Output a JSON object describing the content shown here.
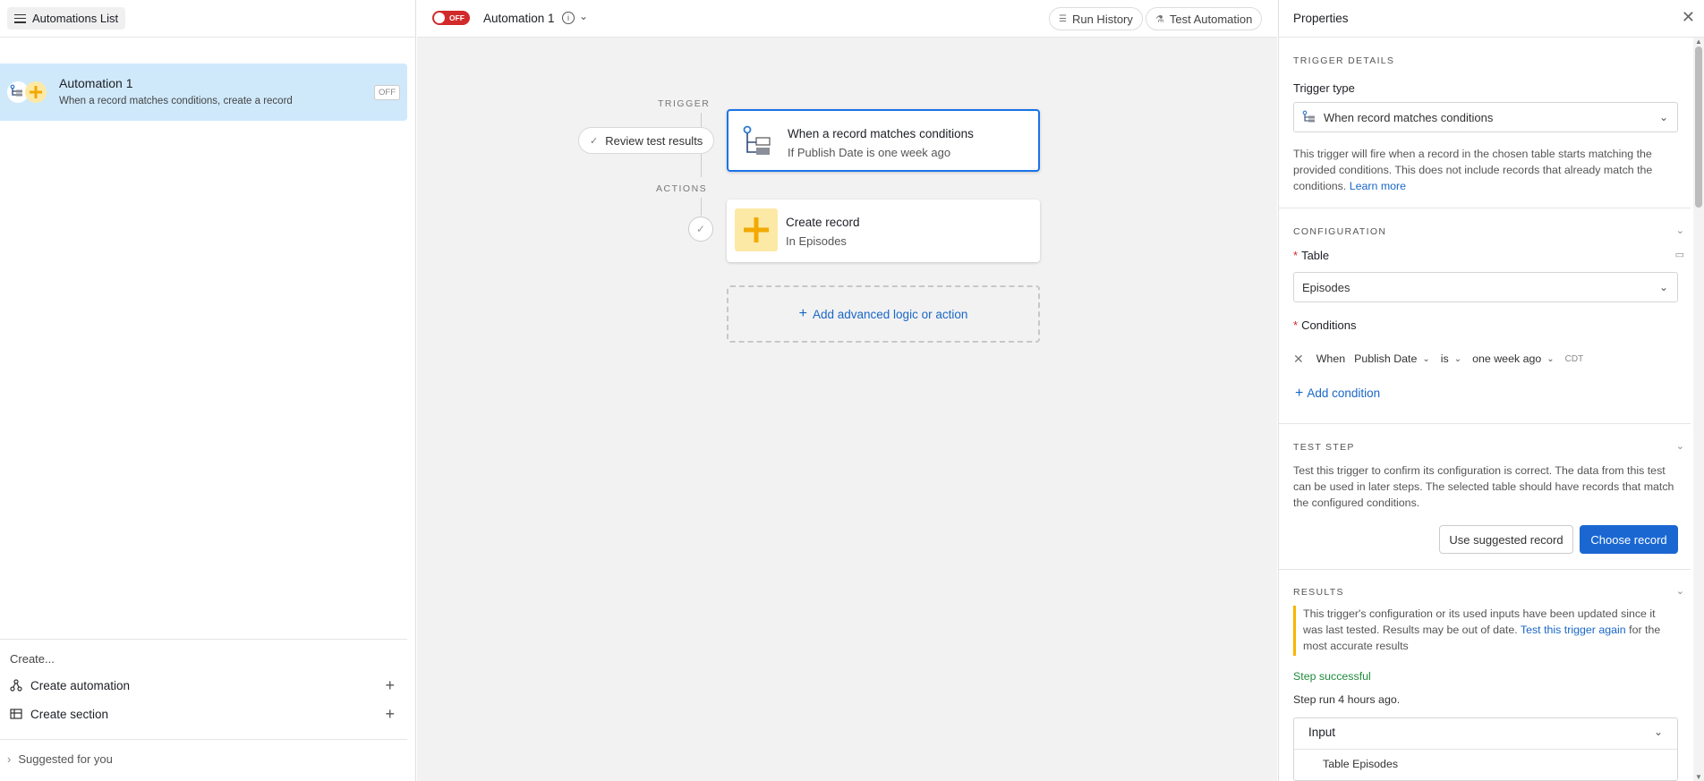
{
  "left": {
    "list_button": "Automations List",
    "automation": {
      "name": "Automation 1",
      "description": "When a record matches conditions, create a record",
      "status": "OFF"
    },
    "create_label": "Create...",
    "create_automation": "Create automation",
    "create_section": "Create section",
    "suggested": "Suggested for you"
  },
  "center": {
    "toggle": "OFF",
    "title": "Automation 1",
    "run_history": "Run History",
    "test_automation": "Test Automation",
    "trigger_label": "TRIGGER",
    "actions_label": "ACTIONS",
    "review": "Review test results",
    "trigger_card": {
      "title": "When a record matches conditions",
      "subtitle": "If Publish Date is one week ago"
    },
    "action_card": {
      "title": "Create record",
      "subtitle": "In Episodes"
    },
    "add_logic": "Add advanced logic or action"
  },
  "right": {
    "title": "Properties",
    "trigger_details": "TRIGGER DETAILS",
    "trigger_type_label": "Trigger type",
    "trigger_type_value": "When record matches conditions",
    "trigger_desc": "This trigger will fire when a record in the chosen table starts matching the provided conditions. This does not include records that already match the conditions.",
    "learn_more": "Learn more",
    "configuration": "CONFIGURATION",
    "table_label": "Table",
    "table_value": "Episodes",
    "conditions_label": "Conditions",
    "condition": {
      "when": "When",
      "field": "Publish Date",
      "op": "is",
      "value": "one week ago",
      "tz": "CDT"
    },
    "add_condition": "Add condition",
    "test_step": "TEST STEP",
    "test_desc": "Test this trigger to confirm its configuration is correct. The data from this test can be used in later steps. The selected table should have records that match the configured conditions.",
    "use_suggested": "Use suggested record",
    "choose_record": "Choose record",
    "results": "RESULTS",
    "warn_before": "This trigger's configuration or its used inputs have been updated since it was last tested. Results may be out of date.",
    "warn_link": "Test this trigger again",
    "warn_after": "for the most accurate results",
    "step_success": "Step successful",
    "step_run": "Step run 4 hours ago.",
    "input_title": "Input",
    "input_sub": "Table  Episodes"
  },
  "colors": {
    "accent": "#1a67d2",
    "selected_bg": "#cfe9fb",
    "toggle_off": "#d22a2a",
    "warning": "#f6b500",
    "success": "#1f8a3c"
  }
}
